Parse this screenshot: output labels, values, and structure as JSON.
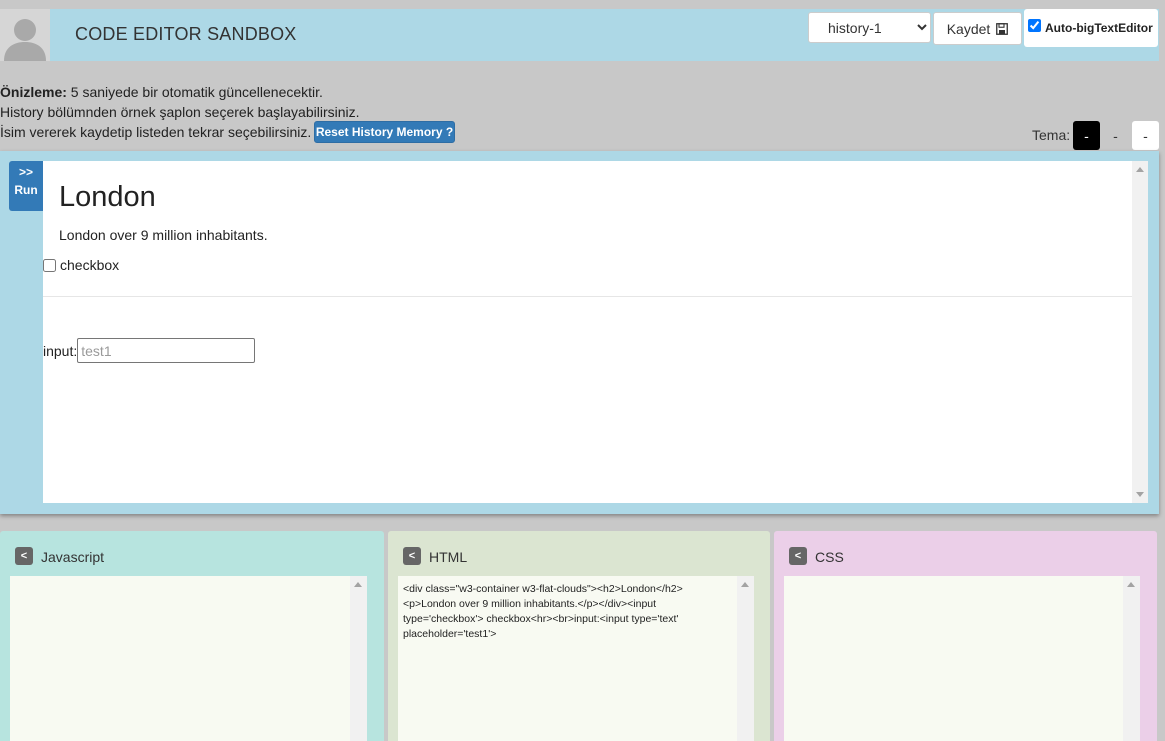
{
  "header": {
    "title": "CODE EDITOR SANDBOX",
    "history_select": {
      "value": "history-1",
      "options": [
        "history-1"
      ]
    },
    "save_label": "Kaydet",
    "auto_editor_label": "Auto-bigTextEditor",
    "auto_editor_checked": true
  },
  "info": {
    "preview_bold": "Önizleme:",
    "preview_text": " 5 saniyede bir otomatik güncellenecektir.",
    "history_text": "History bölümnden örnek şaplon seçerek başlayabilirsiniz.",
    "save_text": "İsim vererek kaydetip listeden tekrar seçebilirsiniz.",
    "reset_label": "Reset History Memory ?"
  },
  "theme": {
    "label": "Tema:",
    "buttons": [
      {
        "label": "-",
        "bg": "#000000",
        "fg": "#ffffff"
      },
      {
        "label": "-",
        "bg": "#c8c8c8",
        "fg": "#333333"
      },
      {
        "label": "-",
        "bg": "#ffffff",
        "fg": "#333333"
      }
    ]
  },
  "run": {
    "arrows": ">>",
    "label": "Run"
  },
  "preview": {
    "heading": "London",
    "paragraph": "London over 9 million inhabitants.",
    "checkbox_label": "checkbox",
    "input_label": "input:",
    "input_placeholder": "test1"
  },
  "editors": {
    "javascript": {
      "title": "Javascript",
      "toggle": "<",
      "code": ""
    },
    "html": {
      "title": "HTML",
      "toggle": "<",
      "code": "<div class=\"w3-container w3-flat-clouds\"><h2>London</h2><p>London over 9 million inhabitants.</p></div><input type='checkbox'> checkbox<hr><br>input:<input type='text' placeholder='test1'>"
    },
    "css": {
      "title": "CSS",
      "toggle": "<",
      "code": ""
    }
  },
  "colors": {
    "header_bg": "#add8e6",
    "page_bg": "#c8c8c8",
    "primary_blue": "#337ab7",
    "js_panel": "#b7e4df",
    "html_panel": "#dbe5d1",
    "css_panel": "#ebcfe8"
  }
}
